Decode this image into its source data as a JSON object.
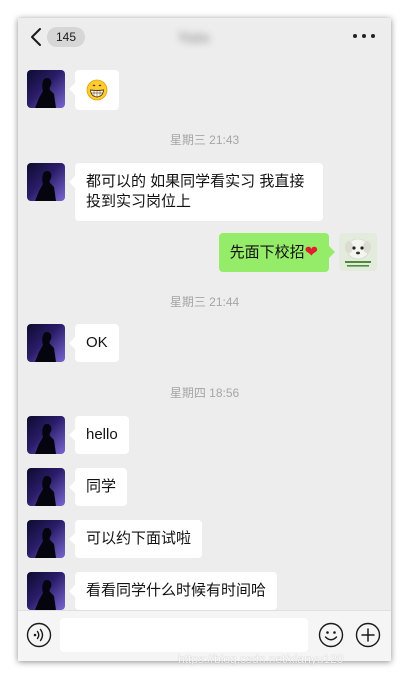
{
  "header": {
    "unread_count": "145",
    "chat_title": "Yuzu"
  },
  "messages": {
    "m1_emoji": "grinning-face",
    "t1": "星期三 21:43",
    "m2_line1": "都可以的 如果同学看实习 我直接",
    "m2_line2": "投到实习岗位上",
    "m3_text": "先面下校招",
    "m3_emoji": "❤️",
    "t2": "星期三 21:44",
    "m4": "OK",
    "t3": "星期四 18:56",
    "m5": "hello",
    "m6": "同学",
    "m7": "可以约下面试啦",
    "m8": "看看同学什么时候有时间哈"
  },
  "input": {
    "placeholder": "",
    "value": ""
  },
  "watermark": "https://blog.csdn.net/xianyu120",
  "colors": {
    "background": "#ededed",
    "self_bubble": "#95ec69",
    "other_bubble": "#ffffff",
    "timestamp": "#a6a6a6"
  }
}
